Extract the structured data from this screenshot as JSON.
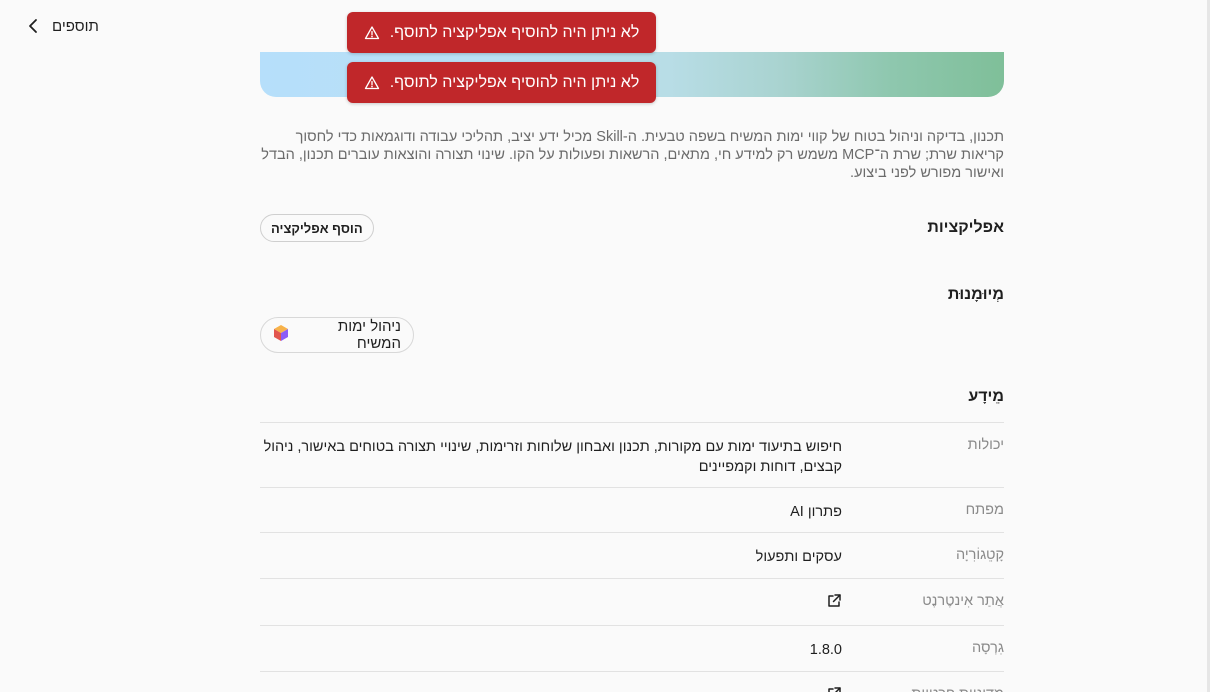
{
  "header": {
    "back_label": "תוספים"
  },
  "toasts": [
    {
      "message": "לא ניתן היה להוסיף אפליקציה לתוסף."
    },
    {
      "message": "לא ניתן היה להוסיף אפליקציה לתוסף."
    }
  ],
  "description": "תכנון, בדיקה וניהול בטוח של קווי ימות המשיח בשפה טבעית. ה-Skill מכיל ידע יציב, תהליכי עבודה ודוגמאות כדי לחסוך קריאות שרת; שרת ה־MCP משמש רק למידע חי, מתאים, הרשאות ופעולות על הקו. שינוי תצורה והוצאות עוברים תכנון, הבדל ואישור מפורש לפני ביצוע.",
  "apps": {
    "title": "אפליקציות",
    "add_button": "הוסף אפליקציה"
  },
  "skills": {
    "title": "מְיוּמָנוּת",
    "chip_label": "ניהול ימות המשיח"
  },
  "info": {
    "title": "מֵידָע",
    "rows": [
      {
        "key": "יכולות",
        "value": "חיפוש בתיעוד ימות עם מקורות, תכנון ואבחון שלוחות וזרימות, שינויי תצורה בטוחים באישור, ניהול קבצים, דוחות וקמפיינים"
      },
      {
        "key": "מפתח",
        "value": "פתרון AI"
      },
      {
        "key": "קָטֵגוֹרִיָה",
        "value": "עסקים ותפעול"
      },
      {
        "key": "אֲתַר אִינטֶרנֶט",
        "value": ""
      },
      {
        "key": "גִרְסָה",
        "value": "1.8.0"
      },
      {
        "key": "מדיניות פרטיות",
        "value": ""
      }
    ]
  },
  "colors": {
    "toast_bg": "#c0272a",
    "background": "#fafafa"
  }
}
